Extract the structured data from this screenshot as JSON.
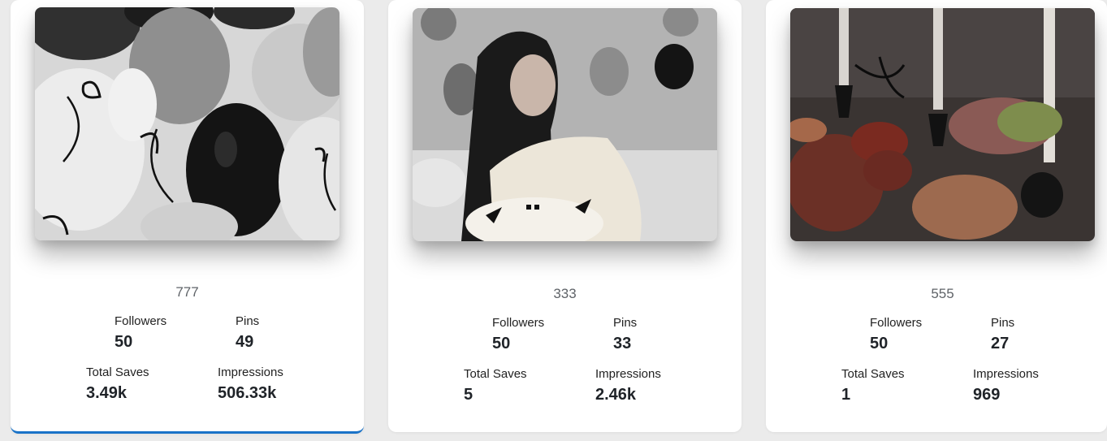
{
  "colors": {
    "active_underline": "#1a73c8",
    "card_bg": "#ffffff",
    "page_bg": "#ebebeb"
  },
  "cards": [
    {
      "name": "777",
      "image": "balloons-photo",
      "active": true,
      "followers_label": "Followers",
      "followers": "50",
      "pins_label": "Pins",
      "pins": "49",
      "saves_label": "Total Saves",
      "saves": "3.49k",
      "impressions_label": "Impressions",
      "impressions": "506.33k"
    },
    {
      "name": "333",
      "image": "portrait-photo",
      "active": false,
      "followers_label": "Followers",
      "followers": "50",
      "pins_label": "Pins",
      "pins": "33",
      "saves_label": "Total Saves",
      "saves": "5",
      "impressions_label": "Impressions",
      "impressions": "2.46k"
    },
    {
      "name": "555",
      "image": "party-table-photo",
      "active": false,
      "followers_label": "Followers",
      "followers": "50",
      "pins_label": "Pins",
      "pins": "27",
      "saves_label": "Total Saves",
      "saves": "1",
      "impressions_label": "Impressions",
      "impressions": "969"
    }
  ]
}
